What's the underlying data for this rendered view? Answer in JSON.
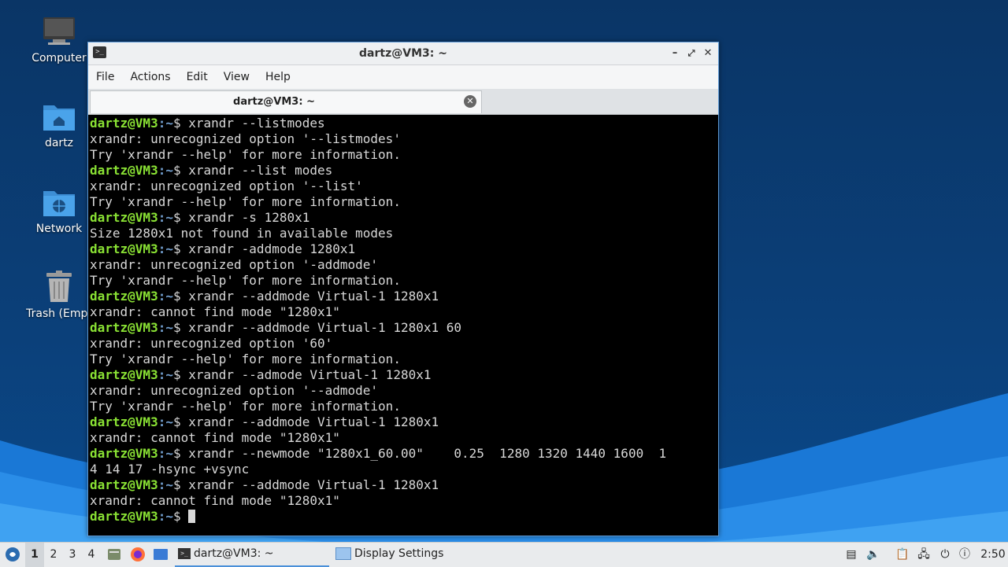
{
  "desktop": {
    "icons": [
      {
        "label": "Computer"
      },
      {
        "label": "dartz"
      },
      {
        "label": "Network"
      },
      {
        "label": "Trash (Empt"
      }
    ]
  },
  "window": {
    "title": "dartz@VM3: ~",
    "menu": [
      "File",
      "Actions",
      "Edit",
      "View",
      "Help"
    ],
    "tab_title": "dartz@VM3: ~",
    "colors": {
      "prompt_user": "#8ae234",
      "prompt_path": "#729fcf",
      "text": "#d8d8d8",
      "background": "#000000"
    }
  },
  "terminal": {
    "prompt_user": "dartz@VM3",
    "prompt_path": ":~",
    "prompt_symbol": "$ ",
    "lines": [
      {
        "type": "cmd",
        "text": "xrandr --listmodes"
      },
      {
        "type": "out",
        "text": "xrandr: unrecognized option '--listmodes'"
      },
      {
        "type": "out",
        "text": "Try 'xrandr --help' for more information."
      },
      {
        "type": "cmd",
        "text": "xrandr --list modes"
      },
      {
        "type": "out",
        "text": "xrandr: unrecognized option '--list'"
      },
      {
        "type": "out",
        "text": "Try 'xrandr --help' for more information."
      },
      {
        "type": "cmd",
        "text": "xrandr -s 1280x1"
      },
      {
        "type": "out",
        "text": "Size 1280x1 not found in available modes"
      },
      {
        "type": "cmd",
        "text": "xrandr -addmode 1280x1"
      },
      {
        "type": "out",
        "text": "xrandr: unrecognized option '-addmode'"
      },
      {
        "type": "out",
        "text": "Try 'xrandr --help' for more information."
      },
      {
        "type": "cmd",
        "text": "xrandr --addmode Virtual-1 1280x1"
      },
      {
        "type": "out",
        "text": "xrandr: cannot find mode \"1280x1\""
      },
      {
        "type": "cmd",
        "text": "xrandr --addmode Virtual-1 1280x1 60"
      },
      {
        "type": "out",
        "text": "xrandr: unrecognized option '60'"
      },
      {
        "type": "out",
        "text": "Try 'xrandr --help' for more information."
      },
      {
        "type": "cmd",
        "text": "xrandr --admode Virtual-1 1280x1"
      },
      {
        "type": "out",
        "text": "xrandr: unrecognized option '--admode'"
      },
      {
        "type": "out",
        "text": "Try 'xrandr --help' for more information."
      },
      {
        "type": "cmd",
        "text": "xrandr --addmode Virtual-1 1280x1"
      },
      {
        "type": "out",
        "text": "xrandr: cannot find mode \"1280x1\""
      },
      {
        "type": "cmd",
        "text": "xrandr --newmode \"1280x1_60.00\"    0.25  1280 1320 1440 1600  1"
      },
      {
        "type": "out",
        "text": "4 14 17 -hsync +vsync"
      },
      {
        "type": "cmd",
        "text": "xrandr --addmode Virtual-1 1280x1"
      },
      {
        "type": "out",
        "text": "xrandr: cannot find mode \"1280x1\""
      },
      {
        "type": "cmd",
        "text": "",
        "cursor": true
      }
    ]
  },
  "taskbar": {
    "workspaces": [
      "1",
      "2",
      "3",
      "4"
    ],
    "active_workspace": "1",
    "tasks": [
      {
        "label": "dartz@VM3: ~",
        "active": true
      },
      {
        "label": "Display Settings",
        "active": false
      }
    ],
    "clock": "2:50"
  }
}
